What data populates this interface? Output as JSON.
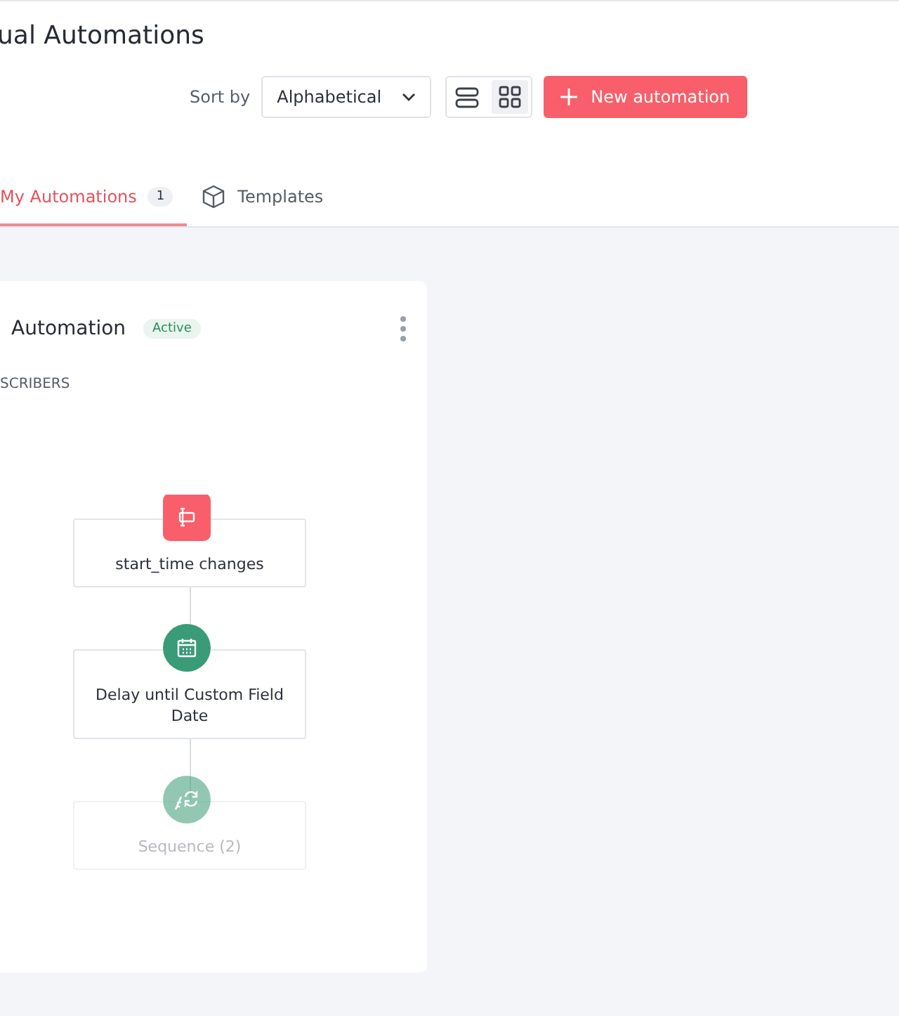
{
  "page": {
    "title": "ual Automations"
  },
  "toolbar": {
    "sort_label": "Sort by",
    "sort_value": "Alphabetical",
    "view_modes": [
      {
        "kind": "list",
        "selected": false
      },
      {
        "kind": "grid",
        "selected": true
      }
    ],
    "new_button": "New automation"
  },
  "tabs": [
    {
      "label": "My Automations",
      "count": "1",
      "selected": true
    },
    {
      "label": "Templates",
      "selected": false
    }
  ],
  "card": {
    "title": "Automation",
    "status": "Active",
    "audience": "SCRIBERS",
    "steps": [
      {
        "kind": "trigger",
        "label": "start_time changes"
      },
      {
        "kind": "delay",
        "label": "Delay until Custom Field Date"
      },
      {
        "kind": "sequence",
        "label": "Sequence (2)"
      }
    ]
  }
}
